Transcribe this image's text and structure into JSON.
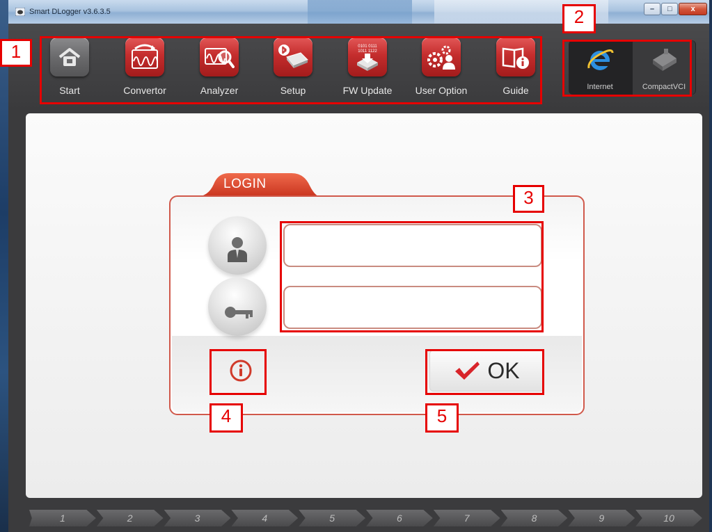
{
  "window": {
    "title": "Smart DLogger v3.6.3.5",
    "minimize_glyph": "–",
    "maximize_glyph": "□",
    "close_glyph": "x"
  },
  "toolbar": {
    "items": [
      {
        "label": "Start",
        "icon": "home-icon"
      },
      {
        "label": "Convertor",
        "icon": "waveform-convert-icon"
      },
      {
        "label": "Analyzer",
        "icon": "waveform-magnify-icon"
      },
      {
        "label": "Setup",
        "icon": "bluetooth-device-icon"
      },
      {
        "label": "FW Update",
        "icon": "chip-download-icon"
      },
      {
        "label": "User Option",
        "icon": "gear-user-icon"
      },
      {
        "label": "Guide",
        "icon": "book-info-icon"
      }
    ],
    "fw_update_icon_digits": [
      "0101 0111",
      "1011 1122"
    ],
    "connections": [
      {
        "label": "Internet",
        "icon": "internet-explorer-icon"
      },
      {
        "label": "CompactVCI",
        "icon": "compactvci-device-icon"
      }
    ]
  },
  "login": {
    "tab_label": "LOGIN",
    "username": {
      "value": "",
      "placeholder": ""
    },
    "password": {
      "value": "",
      "placeholder": ""
    },
    "ok_label": "OK"
  },
  "annotations": [
    "1",
    "2",
    "3",
    "4",
    "5"
  ],
  "steps": [
    "1",
    "2",
    "3",
    "4",
    "5",
    "6",
    "7",
    "8",
    "9",
    "10"
  ],
  "colors": {
    "accent_red": "#c42d2d",
    "annotation_red": "#e60000",
    "toolbar_bg": "#3b3b3d"
  }
}
